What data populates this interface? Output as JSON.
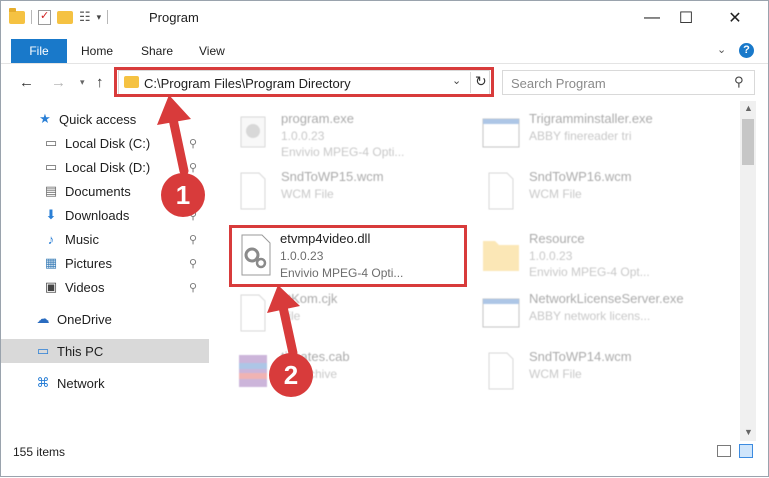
{
  "window": {
    "title": "Program",
    "controls": {
      "minimize": "—",
      "maximize": "☐",
      "close": "✕"
    }
  },
  "ribbon": {
    "tabs": [
      "File",
      "Home",
      "Share",
      "View"
    ]
  },
  "nav": {
    "address_path": "C:\\Program Files\\Program Directory",
    "search_placeholder": "Search Program"
  },
  "sidebar": {
    "items": [
      {
        "label": "Quick access",
        "icon": "star-icon",
        "pinned": false
      },
      {
        "label": "Local Disk (C:)",
        "icon": "drive-icon",
        "pinned": true
      },
      {
        "label": "Local Disk (D:)",
        "icon": "drive-icon",
        "pinned": true
      },
      {
        "label": "Documents",
        "icon": "documents-icon",
        "pinned": true
      },
      {
        "label": "Downloads",
        "icon": "download-icon",
        "pinned": true
      },
      {
        "label": "Music",
        "icon": "music-icon",
        "pinned": true
      },
      {
        "label": "Pictures",
        "icon": "pictures-icon",
        "pinned": true
      },
      {
        "label": "Videos",
        "icon": "videos-icon",
        "pinned": true
      },
      {
        "label": "OneDrive",
        "icon": "cloud-icon",
        "pinned": false
      },
      {
        "label": "This PC",
        "icon": "computer-icon",
        "pinned": false,
        "selected": true
      },
      {
        "label": "Network",
        "icon": "network-icon",
        "pinned": false
      }
    ]
  },
  "files": [
    {
      "name": "program.exe",
      "line2": "1.0.0.23",
      "line3": "Envivio MPEG-4 Opti...",
      "type": "exe-gear"
    },
    {
      "name": "Trigramminstaller.exe",
      "line2": "ABBY finereader tri",
      "line3": "",
      "type": "window"
    },
    {
      "name": "SndToWP15.wcm",
      "line2": "WCM File",
      "line3": "",
      "type": "doc"
    },
    {
      "name": "SndToWP16.wcm",
      "line2": "WCM File",
      "line3": "",
      "type": "doc"
    },
    {
      "name": "etvmp4video.dll",
      "line2": "1.0.0.23",
      "line3": "Envivio MPEG-4 Opti...",
      "type": "dll-gear"
    },
    {
      "name": "Resource",
      "line2": "1.0.0.23",
      "line3": "Envivio MPEG-4 Opt...",
      "type": "folder"
    },
    {
      "name": "xtKom.cjk",
      "line2": "File",
      "line3": "",
      "type": "doc"
    },
    {
      "name": "NetworkLicenseServer.exe",
      "line2": "ABBY network licens...",
      "line3": "",
      "type": "window"
    },
    {
      "name": "tificates.cab",
      "line2": "All Archive",
      "line3": "",
      "type": "archive"
    },
    {
      "name": "SndToWP14.wcm",
      "line2": "WCM File",
      "line3": "",
      "type": "doc"
    }
  ],
  "status": {
    "count": "155 items"
  },
  "annotations": {
    "step1": "1",
    "step2": "2"
  },
  "colors": {
    "accent": "#1979ca",
    "highlight": "#d83b3b",
    "selected_bg": "#d9d9d9"
  }
}
